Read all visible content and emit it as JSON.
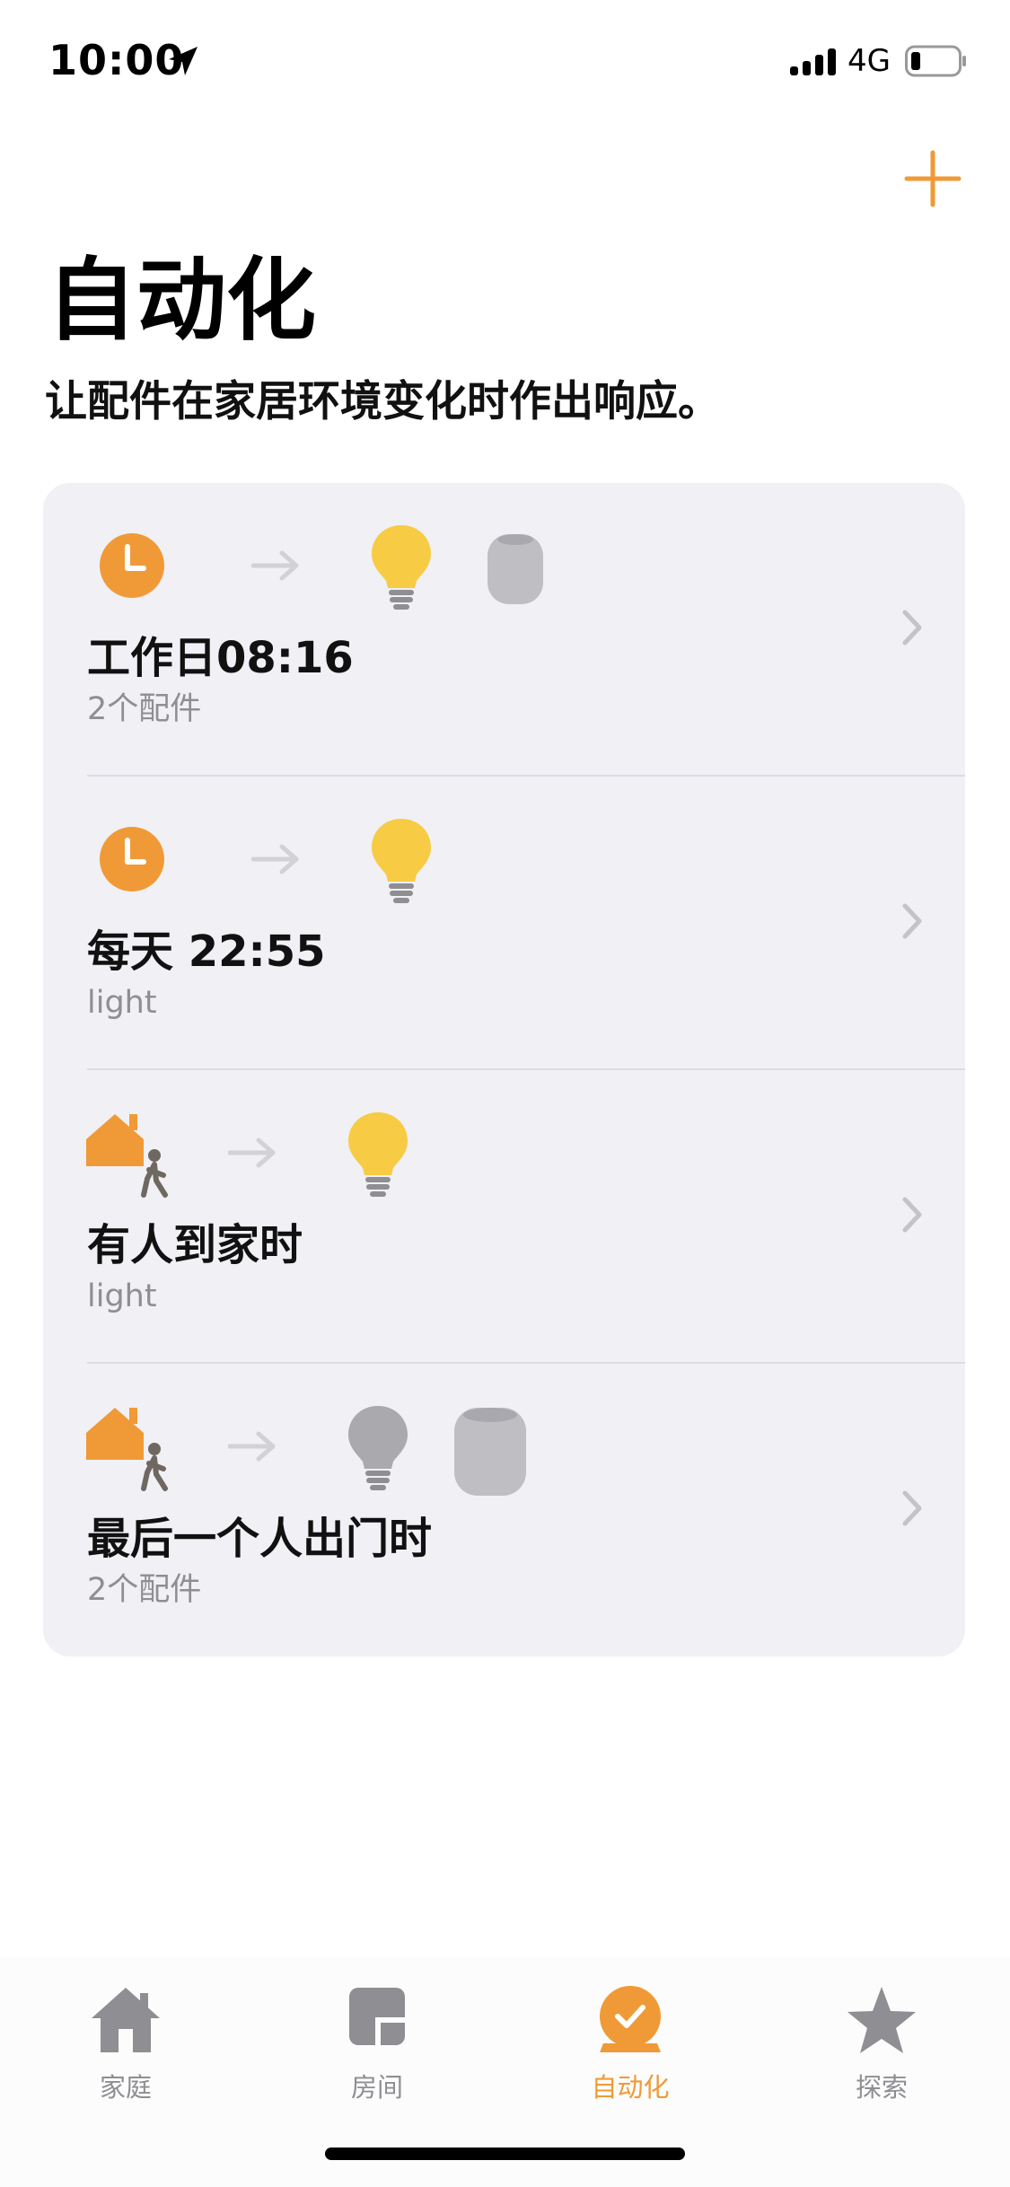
{
  "status_bar": {
    "time": "10:00",
    "network": "4G"
  },
  "header": {
    "title": "自动化",
    "subtitle": "让配件在家居环境变化时作出响应。",
    "accent_color": "#f09a37"
  },
  "automations": [
    {
      "trigger_icon": "clock-icon",
      "action_icons": [
        "lightbulb-on-icon",
        "homepod-mini-icon"
      ],
      "title": "工作日08:16",
      "subtitle": "2个配件"
    },
    {
      "trigger_icon": "clock-icon",
      "action_icons": [
        "lightbulb-on-icon"
      ],
      "title": "每天 22:55",
      "subtitle": "light"
    },
    {
      "trigger_icon": "person-arrives-home-icon",
      "action_icons": [
        "lightbulb-on-icon"
      ],
      "title": "有人到家时",
      "subtitle": "light"
    },
    {
      "trigger_icon": "person-leaves-home-icon",
      "action_icons": [
        "lightbulb-off-icon",
        "homepod-icon"
      ],
      "title": "最后一个人出门时",
      "subtitle": "2个配件"
    }
  ],
  "tab_bar": {
    "tabs": [
      {
        "label": "家庭",
        "icon": "house-icon"
      },
      {
        "label": "房间",
        "icon": "rooms-icon"
      },
      {
        "label": "自动化",
        "icon": "automation-clock-check-icon"
      },
      {
        "label": "探索",
        "icon": "star-icon"
      }
    ],
    "active_index": 2
  }
}
